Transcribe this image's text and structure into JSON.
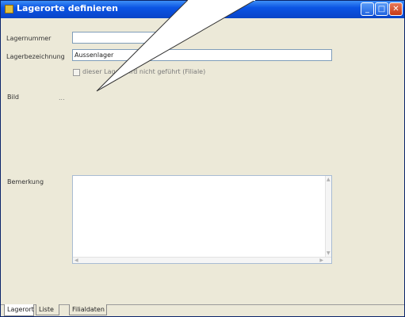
{
  "window": {
    "title": "Lagerorte definieren",
    "buttons": {
      "minimize": "_",
      "maximize": "□",
      "close": "✕"
    }
  },
  "form": {
    "lagernummer_label": "Lagernummer",
    "lagernummer_value": "",
    "lagerbezeichnung_label": "Lagerbezeichnung",
    "lagerbezeichnung_value": "Aussenlager",
    "checkbox_label": "dieser Lager wird nicht geführt (Filiale)",
    "checkbox_checked": false,
    "bild_label": "Bild",
    "bild_button": "...",
    "bemerkung_label": "Bemerkung",
    "bemerkung_value": ""
  },
  "tabs": [
    {
      "label": "Lagerort",
      "active": true
    },
    {
      "label": "Liste",
      "active": false
    },
    {
      "label": "Filialdaten",
      "active": false
    }
  ]
}
